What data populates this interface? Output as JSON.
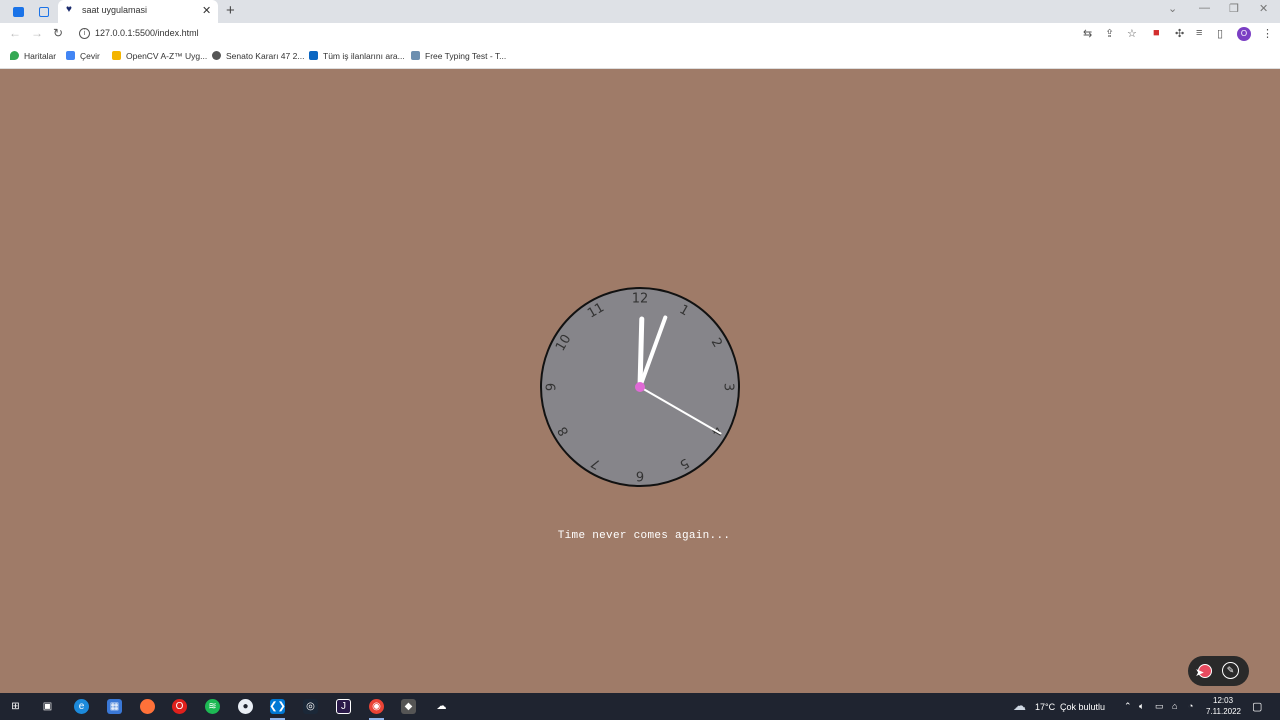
{
  "browser": {
    "active_tab_title": "saat uygulamasi",
    "tab_close": "✕",
    "new_tab": "+",
    "url": "127.0.0.1:5500/index.html",
    "profile_initial": "O",
    "bookmarks": [
      {
        "label": "Haritalar",
        "color": "#34a853"
      },
      {
        "label": "Çevir",
        "color": "#4285f4"
      },
      {
        "label": "OpenCV A-Z™ Uyg...",
        "color": "#f4b400"
      },
      {
        "label": "Senato Kararı 47 2...",
        "color": "#555555"
      },
      {
        "label": "Tüm iş ilanlarını ara...",
        "color": "#0a66c2"
      },
      {
        "label": "Free Typing Test - T...",
        "color": "#6d8fb0"
      }
    ]
  },
  "page": {
    "background": "#9f7b68",
    "clock": {
      "face_color": "#86858a",
      "numbers": [
        "12",
        "1",
        "2",
        "3",
        "4",
        "5",
        "6",
        "7",
        "8",
        "9",
        "10",
        "11"
      ],
      "time": {
        "hour": 12,
        "minute": 3,
        "second": 20
      }
    },
    "quote": "Time never comes again..."
  },
  "taskbar": {
    "weather_temp": "17°C",
    "weather_text": "Çok bulutlu",
    "time": "12:03",
    "date": "7.11.2022"
  }
}
